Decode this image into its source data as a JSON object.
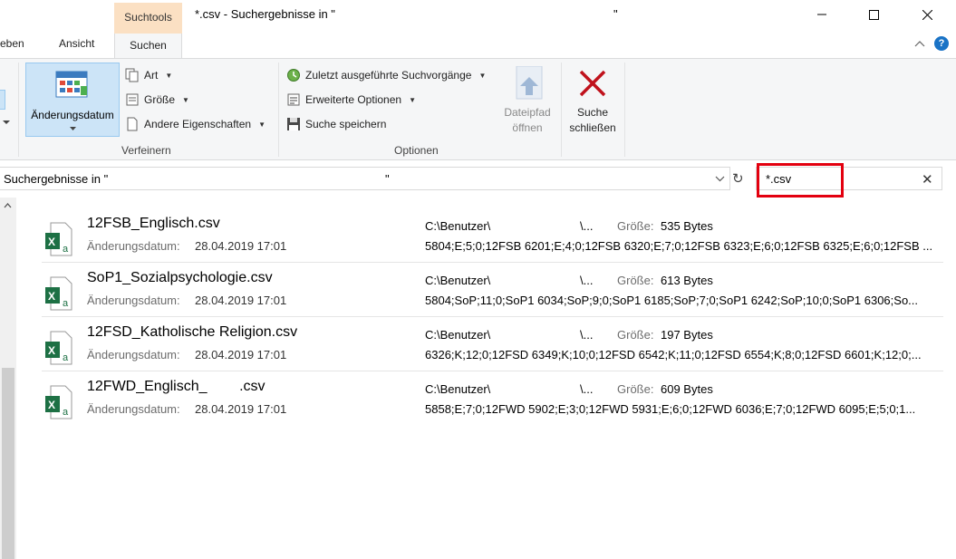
{
  "window": {
    "title_part1": "*.csv - Suchergebnisse in \"",
    "title_part2": "\"",
    "context_tab_header": "Suchtools"
  },
  "tabs": {
    "partial_left": "eben",
    "view": "Ansicht",
    "search": "Suchen"
  },
  "ribbon": {
    "refine_group": {
      "label": "Verfeinern",
      "date_modified": "Änderungsdatum",
      "kind": "Art",
      "size": "Größe",
      "other_props": "Andere Eigenschaften"
    },
    "options_group": {
      "label": "Optionen",
      "recent_searches": "Zuletzt ausgeführte Suchvorgänge",
      "advanced_options": "Erweiterte Optionen",
      "save_search": "Suche speichern",
      "file_location_line1": "Dateipfad",
      "file_location_line2": "öffnen"
    },
    "close_search_line1": "Suche",
    "close_search_line2": "schließen"
  },
  "address": {
    "path_part1": "Suchergebnisse in \"",
    "path_part2": "\""
  },
  "search": {
    "value": "*.csv",
    "highlight_color": "#e3000f"
  },
  "results": [
    {
      "name": "12FSB_Englisch.csv",
      "date_label": "Änderungsdatum:",
      "date": "28.04.2019 17:01",
      "path1": "C:\\Benutzer\\",
      "path2": "\\...",
      "size_label": "Größe:",
      "size": "535 Bytes",
      "content": "5804;E;5;0;12FSB 6201;E;4;0;12FSB 6320;E;7;0;12FSB 6323;E;6;0;12FSB 6325;E;6;0;12FSB ..."
    },
    {
      "name": "SoP1_Sozialpsychologie.csv",
      "date_label": "Änderungsdatum:",
      "date": "28.04.2019 17:01",
      "path1": "C:\\Benutzer\\",
      "path2": "\\...",
      "size_label": "Größe:",
      "size": "613 Bytes",
      "content": "5804;SoP;11;0;SoP1 6034;SoP;9;0;SoP1 6185;SoP;7;0;SoP1 6242;SoP;10;0;SoP1 6306;So..."
    },
    {
      "name": "12FSD_Katholische Religion.csv",
      "date_label": "Änderungsdatum:",
      "date": "28.04.2019 17:01",
      "path1": "C:\\Benutzer\\",
      "path2": "\\...",
      "size_label": "Größe:",
      "size": "197 Bytes",
      "content": "6326;K;12;0;12FSD 6349;K;10;0;12FSD 6542;K;11;0;12FSD 6554;K;8;0;12FSD 6601;K;12;0;..."
    },
    {
      "name": "12FWD_Englisch_        .csv",
      "date_label": "Änderungsdatum:",
      "date": "28.04.2019 17:01",
      "path1": "C:\\Benutzer\\",
      "path2": "\\...",
      "size_label": "Größe:",
      "size": "609 Bytes",
      "content": "5858;E;7;0;12FWD 5902;E;3;0;12FWD 5931;E;6;0;12FWD 6036;E;7;0;12FWD 6095;E;5;0;1..."
    }
  ]
}
